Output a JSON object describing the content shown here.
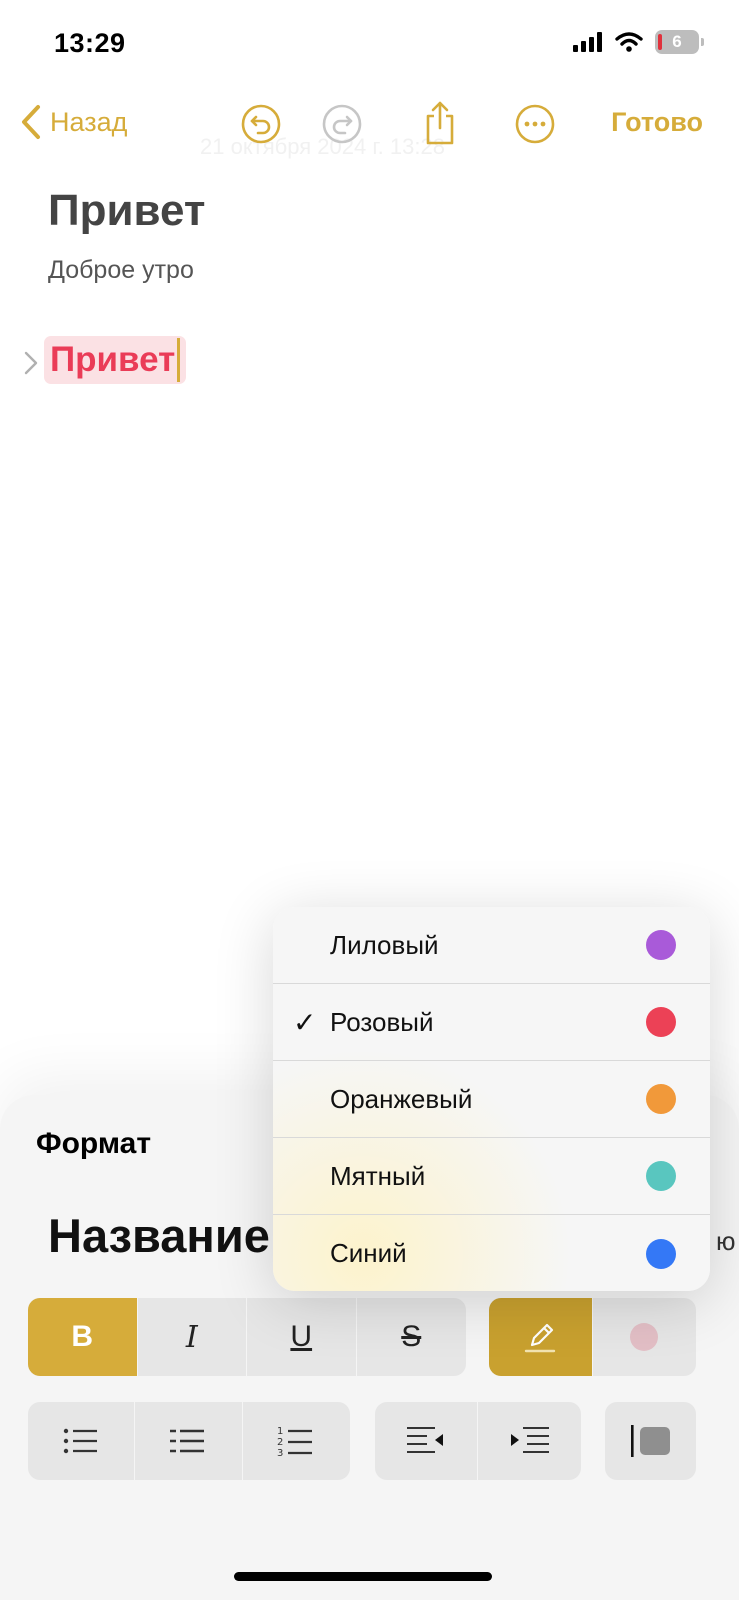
{
  "status": {
    "time": "13:29",
    "battery": "6"
  },
  "nav": {
    "back_label": "Назад",
    "done_label": "Готово",
    "ghost_date": "21 октября 2024 г. 13:28"
  },
  "note": {
    "title": "Привет",
    "subtitle": "Доброе утро",
    "highlighted_text": "Привет"
  },
  "format": {
    "title": "Формат",
    "style_title": "Название",
    "style_more": "ю",
    "bold": "B",
    "italic": "I",
    "underline": "U",
    "strike": "S"
  },
  "colors": {
    "accent": "#d6ac3a",
    "highlight_text": "#ea3c57",
    "highlight_bg": "#fbe1e4"
  },
  "color_menu": {
    "items": [
      {
        "label": "Лиловый",
        "color": "#a95ad9",
        "checked": false
      },
      {
        "label": "Розовый",
        "color": "#ec4156",
        "checked": true
      },
      {
        "label": "Оранжевый",
        "color": "#f1993a",
        "checked": false
      },
      {
        "label": "Мятный",
        "color": "#59c6bf",
        "checked": false
      },
      {
        "label": "Синий",
        "color": "#3478f6",
        "checked": false
      }
    ],
    "check_mark": "✓"
  }
}
